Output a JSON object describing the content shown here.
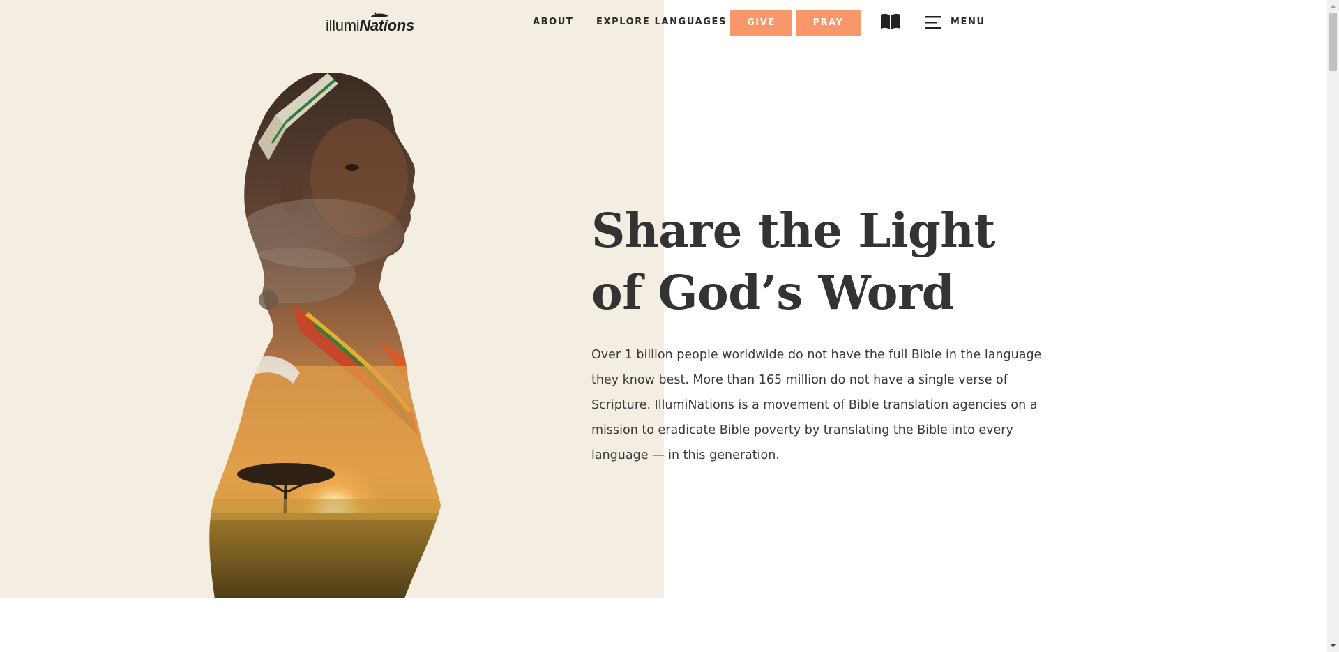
{
  "header": {
    "logo": {
      "light": "illumi",
      "bold": "Nations"
    },
    "nav": {
      "about": "ABOUT",
      "explore": "EXPLORE LANGUAGES"
    },
    "buttons": {
      "give": "GIVE",
      "pray": "PRAY"
    },
    "menu_label": "MENU",
    "icons": {
      "bible": "open-book-icon",
      "menu": "hamburger-menu-icon"
    }
  },
  "hero": {
    "title_line1": "Share the Light",
    "title_line2": "of God’s Word",
    "body": "Over 1 billion people worldwide do not have the full Bible in the language they know best. More than 165 million do not have a single verse of Scripture. IllumiNations is a movement of Bible translation agencies on a mission to eradicate Bible poverty by translating the Bible into every language — in this generation."
  },
  "colors": {
    "accent": "#f8976a",
    "panel": "#f4eee2",
    "text": "#333333"
  }
}
